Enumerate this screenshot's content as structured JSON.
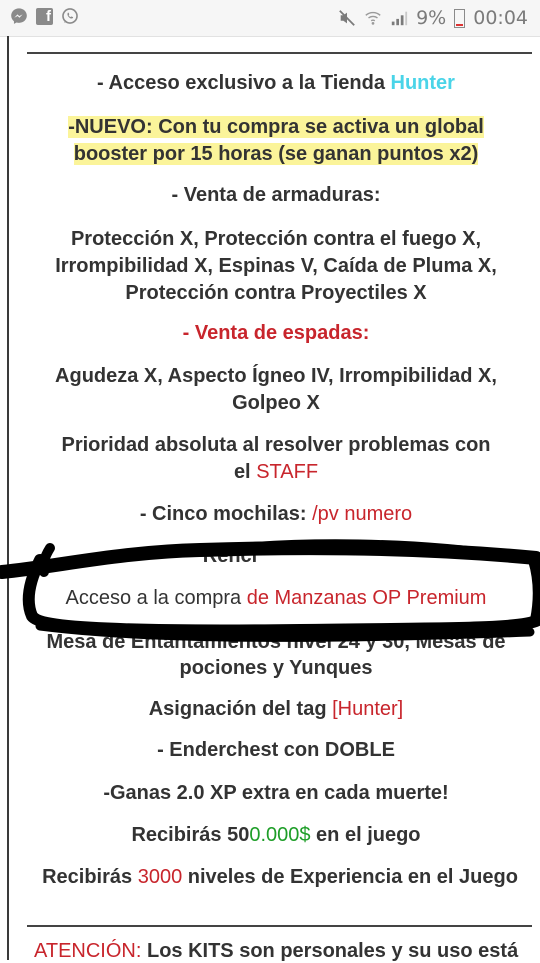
{
  "status_bar": {
    "icons_left": [
      "messenger-icon",
      "facebook-icon",
      "whatsapp-icon"
    ],
    "icons_right": [
      "mute-icon",
      "wifi-icon",
      "signal-icon"
    ],
    "battery": "9%",
    "time": "00:04"
  },
  "content": {
    "tienda_prefix": "- Acceso exclusivo a la Tienda ",
    "tienda_name": "Hunter",
    "nuevo_line1": "-NUEVO: Con tu compra se activa un global",
    "nuevo_line2": "booster por 15 horas (se ganan puntos x2)",
    "armaduras_heading": "- Venta de armaduras:",
    "armaduras_line1": "Protección X, Protección contra el fuego X,",
    "armaduras_line2": "Irrompibilidad X, Espinas V, Caída de Pluma X,",
    "armaduras_line3": "Protección contra Proyectiles X",
    "espadas_heading": "- Venta de espadas:",
    "espadas_line1": "Agudeza X, Aspecto Ígneo IV, Irrompibilidad X,",
    "espadas_line2": "Golpeo X",
    "prioridad_line1": "Prioridad absoluta al resolver problemas con",
    "prioridad_line2_prefix": "el ",
    "prioridad_line2_staff": "STAFF",
    "mochilas_prefix": "- Cinco mochilas: ",
    "mochilas_cmd": "/pv numero",
    "renci_partial": "Renci",
    "acceso_prefix": "Acceso a la compra ",
    "acceso_red": "de Manzanas OP Premium",
    "mesa_line1": "Mesa de Entantamientos nivel 24 y 30, Mesas de",
    "mesa_line2": "pociones y Yunques",
    "tag_prefix": "Asignación del tag ",
    "tag_name": "[Hunter]",
    "enderchest": "- Enderchest con DOBLE",
    "xp_extra": "-Ganas 2.0 XP extra en cada muerte!",
    "dinero_prefix": "Recibirás 50",
    "dinero_green": "0.000$",
    "dinero_suffix": " en el juego",
    "niveles_prefix": "Recibirás ",
    "niveles_red": "3000",
    "niveles_suffix": " niveles de Experiencia en el Juego",
    "atencion_label": "ATENCIÓN:",
    "atencion_text": " Los KITS son personales y su uso está"
  },
  "colors": {
    "red": "#c8252c",
    "cyan": "#4ad4e8",
    "green": "#1e9e28",
    "highlight": "#fbf49a",
    "marker": "#000000"
  }
}
